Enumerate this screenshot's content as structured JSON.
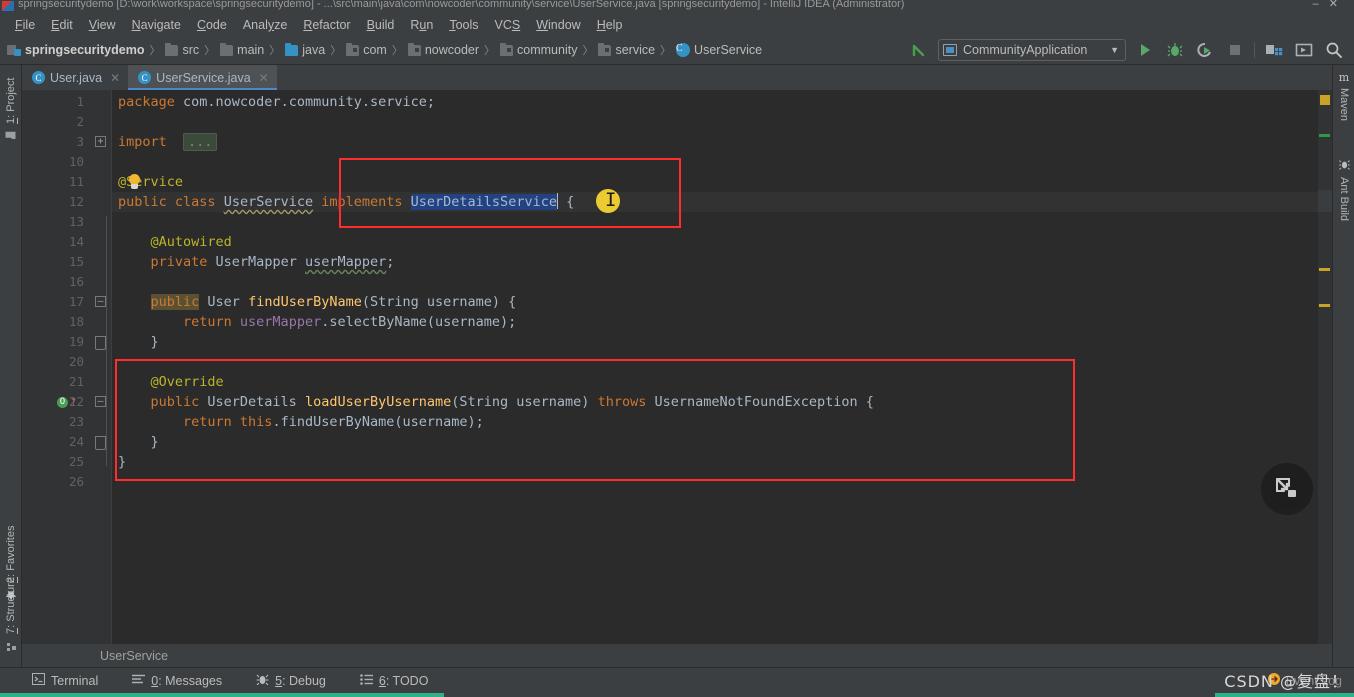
{
  "window": {
    "title": "springsecuritydemo [D:\\work\\workspace\\springsecuritydemo] - ...\\src\\main\\java\\com\\nowcoder\\community\\service\\UserService.java [springsecuritydemo] - IntelliJ IDEA (Administrator)",
    "minimize": "–",
    "maximize": "□",
    "close": "✕"
  },
  "menubar": {
    "items": [
      {
        "label": "File",
        "accel": "F"
      },
      {
        "label": "Edit",
        "accel": "E"
      },
      {
        "label": "View",
        "accel": "V"
      },
      {
        "label": "Navigate",
        "accel": "N"
      },
      {
        "label": "Code",
        "accel": "C"
      },
      {
        "label": "Analyze",
        "accel": "y"
      },
      {
        "label": "Refactor",
        "accel": "R"
      },
      {
        "label": "Build",
        "accel": "B"
      },
      {
        "label": "Run",
        "accel": "u"
      },
      {
        "label": "Tools",
        "accel": "T"
      },
      {
        "label": "VCS",
        "accel": "S"
      },
      {
        "label": "Window",
        "accel": "W"
      },
      {
        "label": "Help",
        "accel": "H"
      }
    ]
  },
  "breadcrumb": {
    "items": [
      {
        "label": "springsecuritydemo",
        "icon": "module-icon"
      },
      {
        "label": "src",
        "icon": "folder-icon"
      },
      {
        "label": "main",
        "icon": "folder-icon"
      },
      {
        "label": "java",
        "icon": "source-folder-icon"
      },
      {
        "label": "com",
        "icon": "package-icon"
      },
      {
        "label": "nowcoder",
        "icon": "package-icon"
      },
      {
        "label": "community",
        "icon": "package-icon"
      },
      {
        "label": "service",
        "icon": "package-icon"
      },
      {
        "label": "UserService",
        "icon": "class-icon"
      }
    ],
    "separator": "〉"
  },
  "toolbar": {
    "back_label": "↖",
    "run_config": "CommunityApplication",
    "run_config_caret": "▼",
    "run_label": "Run",
    "debug_label": "Debug",
    "run_coverage_label": "Run with Coverage",
    "stop_label": "Stop",
    "project_structure_label": "Project Structure",
    "layout_label": "Layout",
    "search_label": "Search Everywhere",
    "search_glyph": "⌕"
  },
  "left_tools": [
    {
      "label": "1: Project",
      "accel": "1",
      "rest": ": Project",
      "icon": "project-folder-icon"
    },
    {
      "label": "2: Favorites",
      "accel": "2",
      "rest": ": Favorites",
      "icon": "star-icon"
    },
    {
      "label": "7: Structure",
      "accel": "7",
      "rest": ": Structure",
      "icon": "structure-icon"
    }
  ],
  "right_tools": [
    {
      "label": "Maven",
      "icon": "maven-icon"
    },
    {
      "label": "Ant Build",
      "icon": "ant-icon"
    }
  ],
  "tabs": [
    {
      "label": "User.java",
      "active": false,
      "close": "✕",
      "icon": "class-icon",
      "letter": "C"
    },
    {
      "label": "UserService.java",
      "active": true,
      "close": "✕",
      "icon": "class-icon",
      "letter": "C"
    }
  ],
  "editor": {
    "line_numbers": [
      "1",
      "2",
      "3",
      "10",
      "11",
      "12",
      "13",
      "14",
      "15",
      "16",
      "17",
      "18",
      "19",
      "20",
      "21",
      "22",
      "23",
      "24",
      "25",
      "26"
    ],
    "folded_placeholder": "...",
    "caret_char": "I",
    "lines": [
      {
        "n": "1",
        "segments": [
          {
            "t": "package",
            "c": "kw"
          },
          {
            "t": " com.nowcoder.community.service;",
            "c": "txt"
          }
        ]
      },
      {
        "n": "2",
        "segments": []
      },
      {
        "n": "3",
        "segments": [
          {
            "t": "import",
            "c": "kw"
          },
          {
            "t": "  ",
            "c": "txt"
          },
          {
            "t": "...",
            "c": "folded"
          }
        ]
      },
      {
        "n": "10",
        "segments": []
      },
      {
        "n": "11",
        "segments": [
          {
            "t": "@Service",
            "c": "ann"
          }
        ]
      },
      {
        "n": "12",
        "segments": [
          {
            "t": "public ",
            "c": "kw"
          },
          {
            "t": "class ",
            "c": "kw"
          },
          {
            "t": "UserService",
            "c": "classwarn"
          },
          {
            "t": " ",
            "c": "txt"
          },
          {
            "t": "implements",
            "c": "kw"
          },
          {
            "t": " ",
            "c": "txt"
          },
          {
            "t": "UserDetailsService",
            "c": "sel"
          },
          {
            "t": " {",
            "c": "txt"
          }
        ]
      },
      {
        "n": "13",
        "segments": []
      },
      {
        "n": "14",
        "segments": [
          {
            "t": "    @Autowired",
            "c": "ann"
          }
        ]
      },
      {
        "n": "15",
        "segments": [
          {
            "t": "    private ",
            "c": "kw"
          },
          {
            "t": "UserMapper ",
            "c": "txt"
          },
          {
            "t": "userMapper",
            "c": "warnfield"
          },
          {
            "t": ";",
            "c": "txt"
          }
        ]
      },
      {
        "n": "16",
        "segments": []
      },
      {
        "n": "17",
        "segments": [
          {
            "t": "    public",
            "c": "kwhl"
          },
          {
            "t": " User ",
            "c": "txt"
          },
          {
            "t": "findUserByName",
            "c": "fn"
          },
          {
            "t": "(String username) {",
            "c": "txt"
          }
        ]
      },
      {
        "n": "18",
        "segments": [
          {
            "t": "        return ",
            "c": "kw"
          },
          {
            "t": "userMapper",
            "c": "fld"
          },
          {
            "t": ".selectByName(username);",
            "c": "txt"
          }
        ]
      },
      {
        "n": "19",
        "segments": [
          {
            "t": "    }",
            "c": "txt"
          }
        ]
      },
      {
        "n": "20",
        "segments": []
      },
      {
        "n": "21",
        "segments": [
          {
            "t": "    @Override",
            "c": "ann"
          }
        ]
      },
      {
        "n": "22",
        "segments": [
          {
            "t": "    public ",
            "c": "kw"
          },
          {
            "t": "UserDetails ",
            "c": "txt"
          },
          {
            "t": "loadUserByUsername",
            "c": "fn"
          },
          {
            "t": "(String username) ",
            "c": "txt"
          },
          {
            "t": "throws",
            "c": "kw"
          },
          {
            "t": " UsernameNotFoundException {",
            "c": "txt"
          }
        ]
      },
      {
        "n": "23",
        "segments": [
          {
            "t": "        return ",
            "c": "kw"
          },
          {
            "t": "this",
            "c": "kw"
          },
          {
            "t": ".findUserByName(username);",
            "c": "txt"
          }
        ]
      },
      {
        "n": "24",
        "segments": [
          {
            "t": "    }",
            "c": "txt"
          }
        ]
      },
      {
        "n": "25",
        "segments": [
          {
            "t": "}",
            "c": "txt"
          }
        ]
      },
      {
        "n": "26",
        "segments": []
      }
    ],
    "gutter_markers": {
      "override_line": "22",
      "override_glyph": "O",
      "override_arrow": "↑"
    },
    "fold_glyphs": {
      "expand": "+",
      "collapse": "–"
    }
  },
  "annotations": {
    "boxes": [
      {
        "name": "implements-clause-highlight"
      },
      {
        "name": "override-method-highlight"
      }
    ],
    "color": "#ff2d2d"
  },
  "marker_bar": {
    "markers": [
      {
        "color": "#c9a227",
        "kind": "warning-block"
      },
      {
        "color": "#2d9947",
        "kind": "vcs-change"
      },
      {
        "color": "#2d9947",
        "kind": "vcs-change"
      },
      {
        "color": "#c9a227",
        "kind": "warning"
      },
      {
        "color": "#c9a227",
        "kind": "warning"
      }
    ]
  },
  "floating_widget": {
    "name": "screen-capture-widget"
  },
  "status": {
    "breadcrumb_text": "UserService"
  },
  "bottom_bar": {
    "items": [
      {
        "label": "Terminal",
        "accel": "",
        "rest": "Terminal",
        "icon": "terminal-icon"
      },
      {
        "label": "0: Messages",
        "accel": "0",
        "rest": ": Messages",
        "icon": "messages-icon"
      },
      {
        "label": "5: Debug",
        "accel": "5",
        "rest": ": Debug",
        "icon": "debug-icon"
      },
      {
        "label": "6: TODO",
        "accel": "6",
        "rest": ": TODO",
        "icon": "todo-icon"
      }
    ],
    "event_log": "Event Log"
  },
  "watermark": {
    "text": "CSDN @复盘！"
  },
  "colors": {
    "accent_blue": "#4a88c7",
    "annotation_red": "#ff2d2d",
    "selection_blue": "#214283",
    "editor_bg": "#2b2b2b",
    "chrome_bg": "#3c3f41",
    "keyword_orange": "#cc7832",
    "annotation_yellow": "#bbb529",
    "method_yellow": "#ffc66d",
    "progress_green": "#2fb28a"
  }
}
